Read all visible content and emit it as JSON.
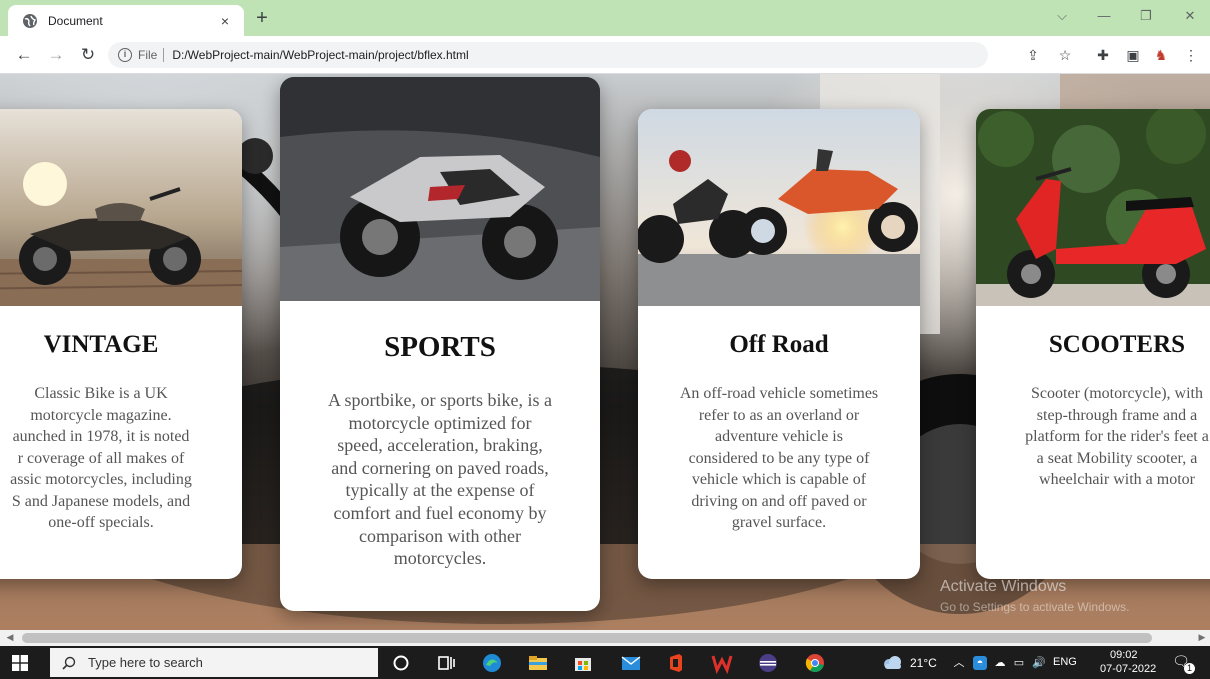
{
  "browser": {
    "tab_title": "Document",
    "tab_close": "×",
    "new_tab": "+",
    "url_scheme": "File",
    "url": "D:/WebProject-main/WebProject-main/project/bflex.html"
  },
  "cards": [
    {
      "title": "VINTAGE",
      "lines": [
        "Classic Bike is a UK",
        "motorcycle magazine.",
        "aunched in 1978, it is noted",
        "r coverage of all makes of",
        "assic motorcycles, including",
        "S and Japanese models, and",
        "one-off specials."
      ]
    },
    {
      "title": "SPORTS",
      "lines": [
        "A sportbike, or sports bike, is a",
        "motorcycle optimized for",
        "speed, acceleration, braking,",
        "and cornering on paved roads,",
        "typically at the expense of",
        "comfort and fuel economy by",
        "comparison with other",
        "motorcycles."
      ]
    },
    {
      "title": "Off Road",
      "lines": [
        "An off-road vehicle sometimes",
        "refer to as an overland or",
        "adventure vehicle is",
        "considered to be any type of",
        "vehicle which is capable of",
        "driving on and off paved or",
        "gravel surface."
      ]
    },
    {
      "title": "SCOOTERS",
      "lines": [
        "Scooter (motorcycle), with",
        "step-through frame and a",
        "platform for the rider's feet a",
        "a seat Mobility scooter, a",
        "wheelchair with a motor"
      ]
    }
  ],
  "watermark": {
    "title": "Activate Windows",
    "subtitle": "Go to Settings to activate Windows."
  },
  "taskbar": {
    "search_placeholder": "Type here to search",
    "weather": "21°C",
    "language": "ENG",
    "time": "09:02",
    "date": "07-07-2022",
    "notifications": "1"
  }
}
